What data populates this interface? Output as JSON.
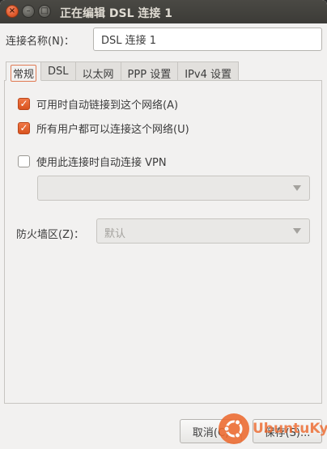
{
  "window": {
    "title": "正在编辑 DSL 连接 1",
    "close_glyph": "×",
    "min_glyph": "–",
    "max_glyph": "□"
  },
  "connection": {
    "name_label": "连接名称(N)：",
    "name_value": "DSL 连接 1"
  },
  "tabs": [
    {
      "label": "常规",
      "active": true
    },
    {
      "label": "DSL",
      "active": false
    },
    {
      "label": "以太网",
      "active": false
    },
    {
      "label": "PPP 设置",
      "active": false
    },
    {
      "label": "IPv4 设置",
      "active": false
    }
  ],
  "general": {
    "auto_connect_label": "可用时自动链接到这个网络(A)",
    "auto_connect_checked": true,
    "all_users_label": "所有用户都可以连接这个网络(U)",
    "all_users_checked": true,
    "vpn_label": "使用此连接时自动连接 VPN",
    "vpn_checked": false,
    "vpn_select_value": "",
    "firewall_label": "防火墙区(Z)：",
    "firewall_value": "默认"
  },
  "footer": {
    "cancel_label": "取消(C)",
    "save_label": "保存(S)..."
  },
  "watermark": {
    "text": "UbuntuKylin"
  },
  "colors": {
    "accent": "#e0582a",
    "titlebar": "#3c3b37",
    "background": "#f2f1f0"
  },
  "icons": {
    "checkmark": "✓",
    "dropdown": "chevron-down-icon"
  }
}
